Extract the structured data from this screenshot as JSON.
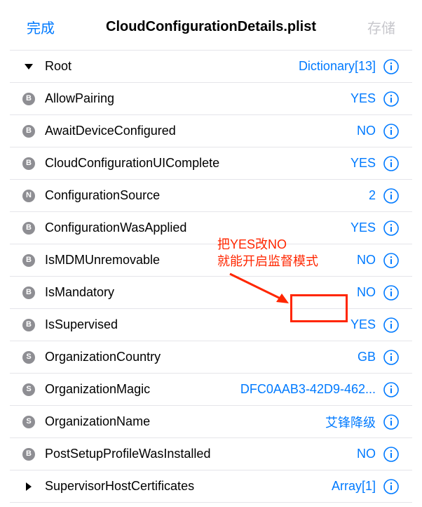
{
  "header": {
    "done": "完成",
    "title": "CloudConfigurationDetails.plist",
    "save": "存储"
  },
  "root": {
    "key": "Root",
    "value": "Dictionary[13]"
  },
  "rows": [
    {
      "type": "B",
      "key": "AllowPairing",
      "value": "YES"
    },
    {
      "type": "B",
      "key": "AwaitDeviceConfigured",
      "value": "NO"
    },
    {
      "type": "B",
      "key": "CloudConfigurationUIComplete",
      "value": "YES"
    },
    {
      "type": "N",
      "key": "ConfigurationSource",
      "value": "2"
    },
    {
      "type": "B",
      "key": "ConfigurationWasApplied",
      "value": "YES"
    },
    {
      "type": "B",
      "key": "IsMDMUnremovable",
      "value": "NO"
    },
    {
      "type": "B",
      "key": "IsMandatory",
      "value": "NO"
    },
    {
      "type": "B",
      "key": "IsSupervised",
      "value": "YES"
    },
    {
      "type": "S",
      "key": "OrganizationCountry",
      "value": "GB"
    },
    {
      "type": "S",
      "key": "OrganizationMagic",
      "value": "DFC0AAB3-42D9-462..."
    },
    {
      "type": "S",
      "key": "OrganizationName",
      "value": "艾锋降级"
    },
    {
      "type": "B",
      "key": "PostSetupProfileWasInstalled",
      "value": "NO"
    },
    {
      "type": "ARR",
      "key": "SupervisorHostCertificates",
      "value": "Array[1]"
    }
  ],
  "annotation": {
    "line1": "把YES改NO",
    "line2": "就能开启监督模式"
  }
}
